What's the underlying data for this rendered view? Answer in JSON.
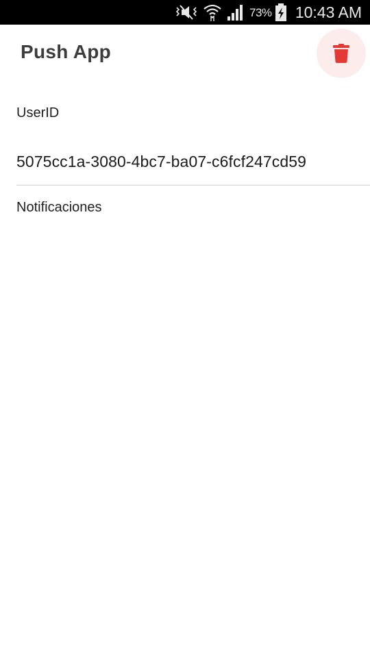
{
  "status_bar": {
    "battery_percent": "73%",
    "time": "10:43 AM",
    "icons": [
      "mute-icon",
      "wifi-icon",
      "signal-icon",
      "battery-charging-icon"
    ]
  },
  "app_bar": {
    "title": "Push App",
    "delete_icon": "trash-icon",
    "delete_color": "#e53935",
    "delete_bg": "#fdecec"
  },
  "content": {
    "userid_label": "UserID",
    "userid_value": "5075cc1a-3080-4bc7-ba07-c6fcf247cd59",
    "notifications_label": "Notificaciones"
  }
}
